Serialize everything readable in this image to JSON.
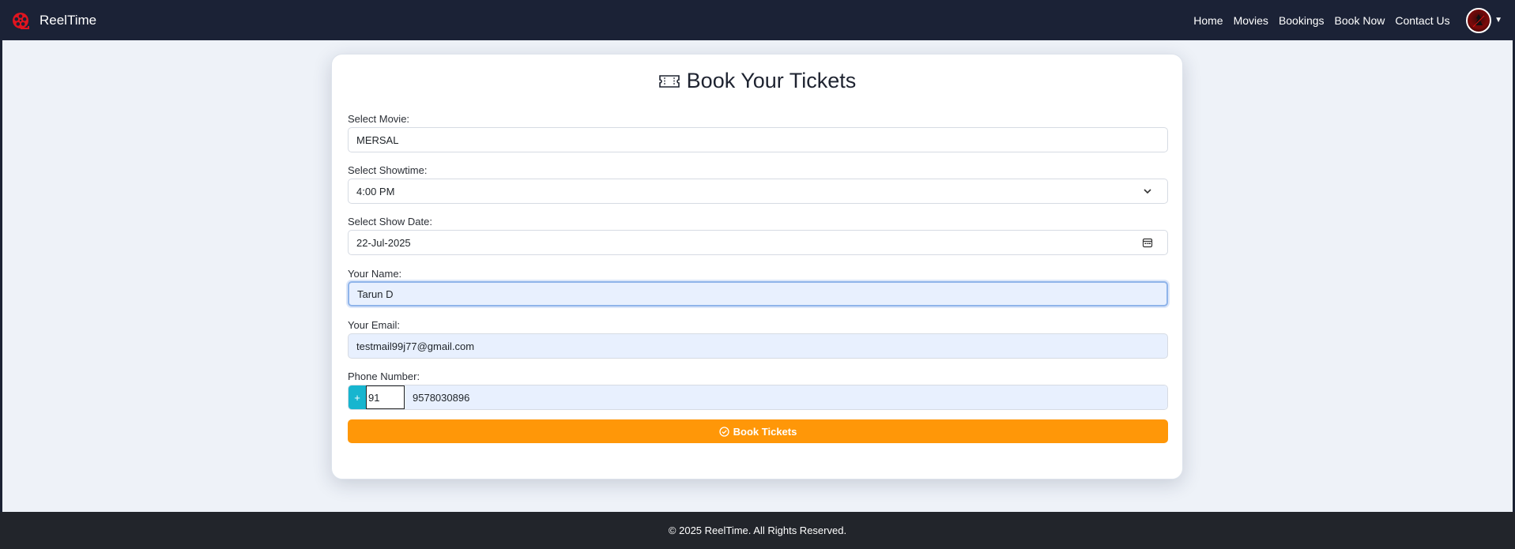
{
  "navbar": {
    "brand": "ReelTime",
    "links": [
      "Home",
      "Movies",
      "Bookings",
      "Book Now",
      "Contact Us"
    ]
  },
  "form": {
    "title": "Book Your Tickets",
    "movie": {
      "label": "Select Movie:",
      "value": "MERSAL"
    },
    "showtime": {
      "label": "Select Showtime:",
      "value": "4:00 PM"
    },
    "date": {
      "label": "Select Show Date:",
      "value": "22-Jul-2025"
    },
    "name": {
      "label": "Your Name:",
      "value": "Tarun D"
    },
    "email": {
      "label": "Your Email:",
      "value": "testmail99j77@gmail.com"
    },
    "phone": {
      "label": "Phone Number:",
      "prefix": "+",
      "code": "91",
      "number": "9578030896"
    },
    "submit_label": "Book Tickets"
  },
  "footer": {
    "text": "© 2025 ReelTime. All Rights Reserved."
  },
  "colors": {
    "navbar": "#1b2236",
    "accent_button": "#ff9708",
    "phone_prefix": "#17b5cf",
    "footer": "#22252b",
    "brand_logo": "#e0141f"
  },
  "icons": {
    "brand": "film-reel-icon",
    "title": "ticket-icon",
    "showtime": "chevron-down-icon",
    "date": "calendar-icon",
    "submit": "check-circle-icon"
  }
}
